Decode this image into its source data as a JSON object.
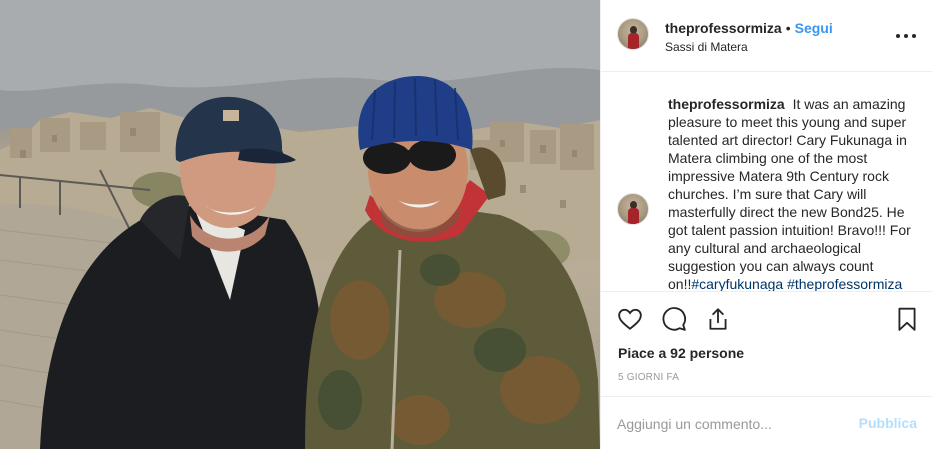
{
  "post": {
    "photo_alt": "",
    "header": {
      "username": "theprofessormiza",
      "separator": "•",
      "follow_label": "Segui",
      "location": "Sassi di Matera",
      "more_icon": "more-horizontal-icon"
    },
    "caption": {
      "username": "theprofessormiza",
      "text": "It was an amazing pleasure to meet this young and super talented art director! Cary Fukunaga in Matera climbing one of the most impressive Matera 9th Century rock churches. I’m sure that Cary will masterfully direct the new Bond25. He got talent passion intuition! Bravo!!! For any cultural and archaeological suggestion you can always count on!!",
      "hashtags": [
        "#caryfukunaga",
        "#theprofessormiza"
      ]
    },
    "actions": {
      "like_icon": "heart-icon",
      "comment_icon": "comment-icon",
      "share_icon": "share-icon",
      "save_icon": "bookmark-icon"
    },
    "likes_text": "Piace a 92 persone",
    "time_ago": "5 GIORNI FA",
    "comment": {
      "placeholder": "Aggiungi un commento...",
      "value": "",
      "publish_label": "Pubblica"
    }
  },
  "colors": {
    "link_blue": "#3897f0",
    "publish_disabled": "#b2dffc",
    "hashtag": "#003569",
    "muted": "#999999",
    "text": "#262626"
  }
}
